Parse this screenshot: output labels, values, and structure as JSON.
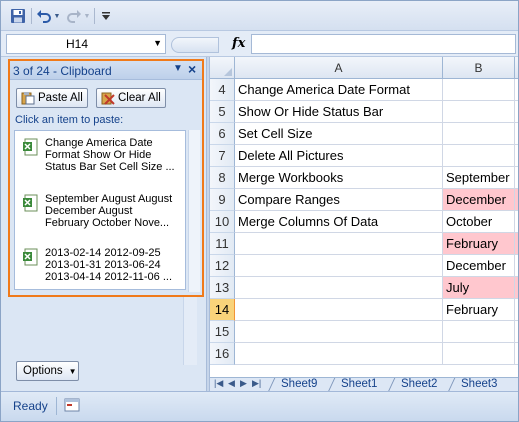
{
  "quick_access": {
    "icons": [
      "save-icon",
      "undo-icon",
      "redo-icon",
      "customize-qat-icon"
    ]
  },
  "formula_bar": {
    "name_box": "H14",
    "fx_label": "fx",
    "formula": ""
  },
  "clipboard": {
    "title": "3 of 24 - Clipboard",
    "paste_all": "Paste All",
    "clear_all": "Clear All",
    "hint": "Click an item to paste:",
    "items": [
      {
        "line1": "Change America Date",
        "line2": "Format Show Or Hide",
        "line3": "Status Bar Set Cell Size ..."
      },
      {
        "line1": "September August August",
        "line2": "December August",
        "line3": "February October Nove..."
      },
      {
        "line1": "2013-02-14 2012-09-25",
        "line2": "2013-01-31 2013-06-24",
        "line3": "2013-04-14 2012-11-06 ..."
      }
    ],
    "options": "Options"
  },
  "sheet": {
    "columns": [
      "A",
      "B"
    ],
    "rows": [
      {
        "num": "4",
        "a": "Change America Date Format",
        "b": "",
        "b_pink": false
      },
      {
        "num": "5",
        "a": "Show Or Hide Status Bar",
        "b": "",
        "b_pink": false
      },
      {
        "num": "6",
        "a": "Set Cell Size",
        "b": "",
        "b_pink": false
      },
      {
        "num": "7",
        "a": "Delete All Pictures",
        "b": "",
        "b_pink": false
      },
      {
        "num": "8",
        "a": "Merge Workbooks",
        "b": "September",
        "b_pink": false
      },
      {
        "num": "9",
        "a": "Compare Ranges",
        "b": "December",
        "b_pink": true
      },
      {
        "num": "10",
        "a": "Merge Columns Of Data",
        "b": "October",
        "b_pink": false
      },
      {
        "num": "11",
        "a": "",
        "b": "February",
        "b_pink": true
      },
      {
        "num": "12",
        "a": "",
        "b": "December",
        "b_pink": false
      },
      {
        "num": "13",
        "a": "",
        "b": "July",
        "b_pink": true
      },
      {
        "num": "14",
        "a": "",
        "b": "February",
        "b_pink": false
      },
      {
        "num": "15",
        "a": "",
        "b": "",
        "b_pink": false
      },
      {
        "num": "16",
        "a": "",
        "b": "",
        "b_pink": false
      }
    ],
    "active_row": "14",
    "pink_color": "#ffc7ce"
  },
  "tabs": [
    "Sheet9",
    "Sheet1",
    "Sheet2",
    "Sheet3"
  ],
  "status": {
    "ready": "Ready"
  }
}
